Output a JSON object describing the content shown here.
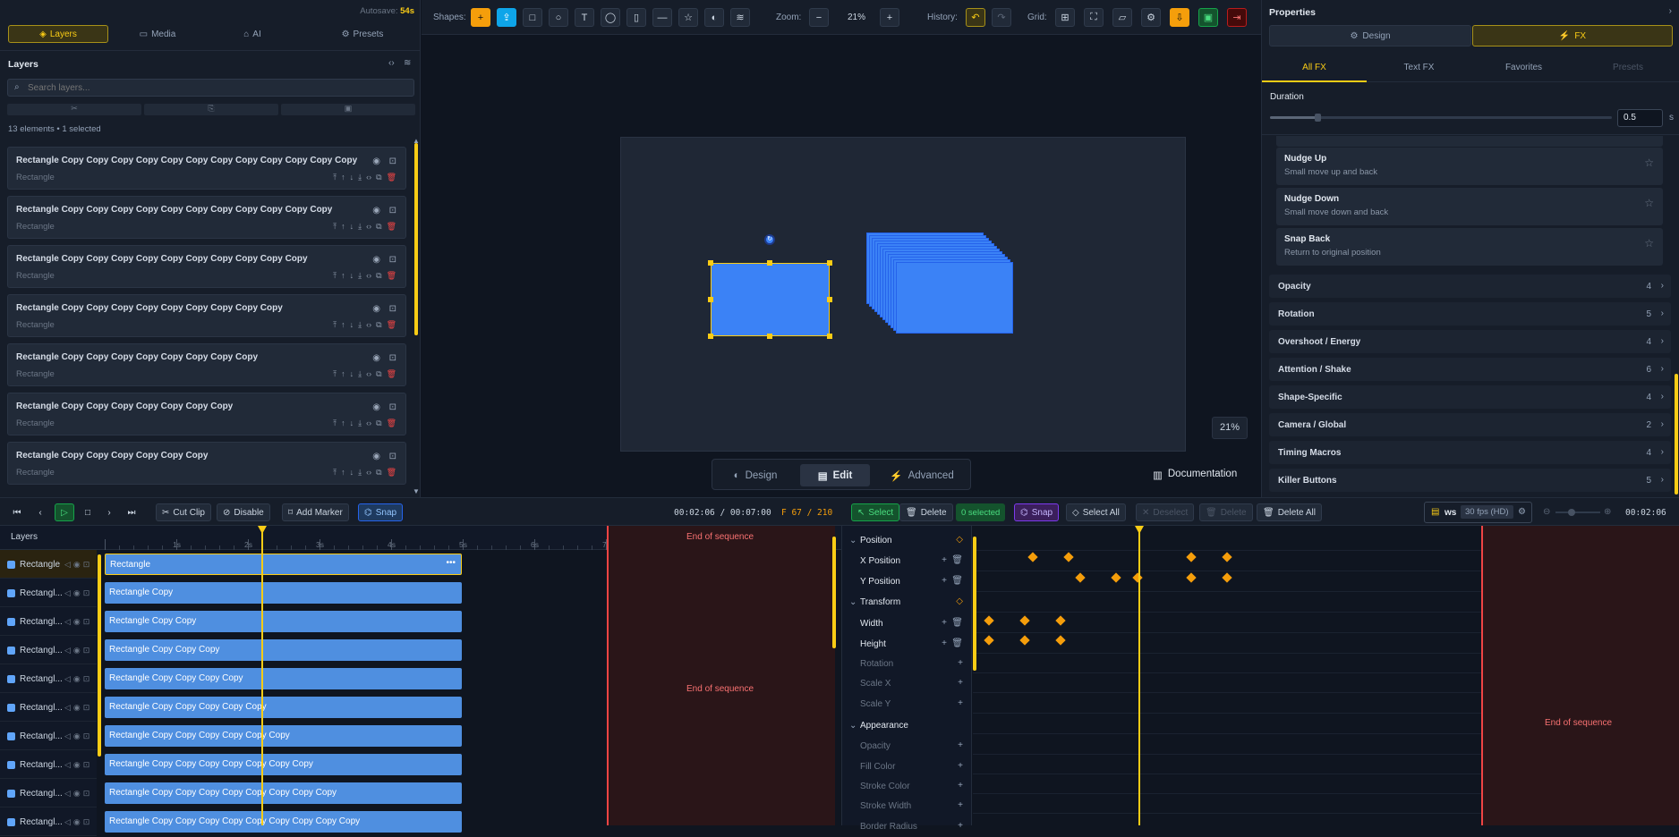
{
  "left_panel": {
    "autosave_label": "Autosave:",
    "autosave_value": "54s",
    "tabs": [
      "Layers",
      "Media",
      "AI",
      "Presets"
    ],
    "layers_title": "Layers",
    "search_placeholder": "Search layers...",
    "summary": "13 elements • 1 selected",
    "cards": [
      {
        "name": "Rectangle Copy Copy Copy Copy Copy Copy Copy Copy Copy Copy Copy Copy",
        "type": "Rectangle"
      },
      {
        "name": "Rectangle Copy Copy Copy Copy Copy Copy Copy Copy Copy Copy Copy",
        "type": "Rectangle"
      },
      {
        "name": "Rectangle Copy Copy Copy Copy Copy Copy Copy Copy Copy Copy",
        "type": "Rectangle"
      },
      {
        "name": "Rectangle Copy Copy Copy Copy Copy Copy Copy Copy Copy",
        "type": "Rectangle"
      },
      {
        "name": "Rectangle Copy Copy Copy Copy Copy Copy Copy Copy",
        "type": "Rectangle"
      },
      {
        "name": "Rectangle Copy Copy Copy Copy Copy Copy Copy",
        "type": "Rectangle"
      },
      {
        "name": "Rectangle Copy Copy Copy Copy Copy Copy",
        "type": "Rectangle"
      }
    ]
  },
  "toolbar": {
    "shapes_label": "Shapes:",
    "zoom_label": "Zoom:",
    "zoom_value": "21%",
    "history_label": "History:",
    "grid_label": "Grid:"
  },
  "canvas": {
    "zoom_badge": "21%",
    "modes": [
      "Design",
      "Edit",
      "Advanced"
    ],
    "documentation": "Documentation"
  },
  "right_panel": {
    "title": "Properties",
    "tabs": [
      "Design",
      "FX"
    ],
    "subtabs": [
      "All FX",
      "Text FX",
      "Favorites",
      "Presets"
    ],
    "duration_label": "Duration",
    "duration_value": "0.5",
    "duration_unit": "s",
    "duration_fraction": 0.14,
    "effects": [
      {
        "title": "Nudge Up",
        "desc": "Small move up and back"
      },
      {
        "title": "Nudge Down",
        "desc": "Small move down and back"
      },
      {
        "title": "Snap Back",
        "desc": "Return to original position"
      }
    ],
    "categories": [
      {
        "name": "Opacity",
        "count": "4"
      },
      {
        "name": "Rotation",
        "count": "5"
      },
      {
        "name": "Overshoot / Energy",
        "count": "4"
      },
      {
        "name": "Attention / Shake",
        "count": "6"
      },
      {
        "name": "Shape-Specific",
        "count": "4"
      },
      {
        "name": "Camera / Global",
        "count": "2"
      },
      {
        "name": "Timing Macros",
        "count": "4"
      },
      {
        "name": "Killer Buttons",
        "count": "5"
      }
    ]
  },
  "transport": {
    "cut_clip": "Cut Clip",
    "disable": "Disable",
    "add_marker": "Add Marker",
    "snap": "Snap",
    "timecode": "00:02:06 / 00:07:00",
    "frame": "F 67 / 210",
    "select": "Select",
    "delete": "Delete",
    "selected_count": "0 selected",
    "snap2": "Snap",
    "select_all": "Select All",
    "deselect": "Deselect",
    "delete2": "Delete",
    "delete_all": "Delete All",
    "ws": "ws",
    "fps": "30 fps (HD)",
    "timecode2": "00:02:06"
  },
  "timeline": {
    "layers_header": "Layers",
    "ruler": [
      "0",
      "1s",
      "2s",
      "3s",
      "4s",
      "5s",
      "6s",
      "7s"
    ],
    "end_label": "End of sequence",
    "tracks": [
      {
        "name": "Rectangle",
        "clip": "Rectangle",
        "selected": true
      },
      {
        "name": "Rectangl...",
        "clip": "Rectangle Copy"
      },
      {
        "name": "Rectangl...",
        "clip": "Rectangle Copy Copy"
      },
      {
        "name": "Rectangl...",
        "clip": "Rectangle Copy Copy Copy"
      },
      {
        "name": "Rectangl...",
        "clip": "Rectangle Copy Copy Copy Copy"
      },
      {
        "name": "Rectangl...",
        "clip": "Rectangle Copy Copy Copy Copy Copy"
      },
      {
        "name": "Rectangl...",
        "clip": "Rectangle Copy Copy Copy Copy Copy Copy"
      },
      {
        "name": "Rectangl...",
        "clip": "Rectangle Copy Copy Copy Copy Copy Copy Copy"
      },
      {
        "name": "Rectangl...",
        "clip": "Rectangle Copy Copy Copy Copy Copy Copy Copy Copy"
      },
      {
        "name": "Rectangl...",
        "clip": "Rectangle Copy Copy Copy Copy Copy Copy Copy Copy Copy"
      }
    ]
  },
  "keyframes": {
    "groups": [
      {
        "name": "Position",
        "props": [
          "X Position",
          "Y Position"
        ]
      },
      {
        "name": "Transform",
        "props": [
          "Width",
          "Height",
          "Rotation",
          "Scale X",
          "Scale Y"
        ]
      },
      {
        "name": "Appearance",
        "props": [
          "Opacity",
          "Fill Color",
          "Stroke Color",
          "Stroke Width",
          "Border Radius"
        ]
      }
    ],
    "end_label": "End of sequence"
  }
}
